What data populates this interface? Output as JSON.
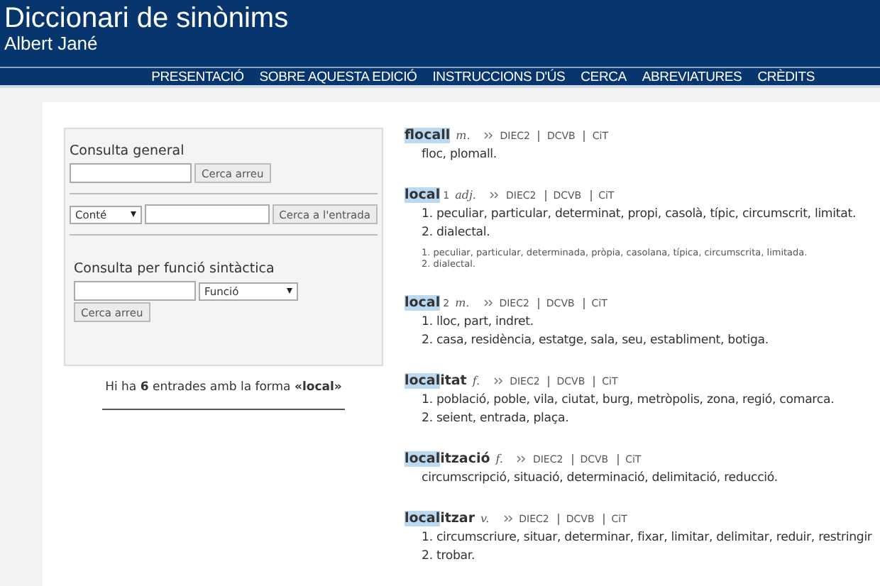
{
  "header": {
    "title": "Diccionari de sinònims",
    "author": "Albert Jané"
  },
  "nav": [
    "PRESENTACIÓ",
    "SOBRE AQUESTA EDICIÓ",
    "INSTRUCCIONS D'ÚS",
    "CERCA",
    "ABREVIATURES",
    "CRÈDITS"
  ],
  "search": {
    "general": {
      "heading": "Consulta general",
      "button": "Cerca arreu"
    },
    "entry": {
      "select": "Conté",
      "button": "Cerca a l'entrada"
    },
    "function": {
      "heading": "Consulta per funció sintàctica",
      "select": "Funció",
      "button": "Cerca arreu"
    },
    "summary": "Hi ha **6** entrades amb la forma **«local»**"
  },
  "entries": [
    {
      "match": "flocall",
      "gram": "m.",
      "links": [
        "DIEC2",
        "DCVB",
        "CiT"
      ],
      "senses": [
        {
          "text": "floc, plomall."
        }
      ]
    },
    {
      "match": "local",
      "sup": "1",
      "gram": "adj.",
      "links": [
        "DIEC2",
        "DCVB",
        "CiT"
      ],
      "senses": [
        {
          "num": "1.",
          "text": "peculiar, particular, determinat, propi, casolà, típic, circumscrit, limitat."
        },
        {
          "num": "2.",
          "text": "dialectal."
        }
      ],
      "notes": [
        {
          "num": "1.",
          "text": "peculiar, particular, determinada, pròpia, casolana, típica, circumscrita, limitada."
        },
        {
          "num": "2.",
          "text": "dialectal."
        }
      ]
    },
    {
      "match": "local",
      "sup": "2",
      "gram": "m.",
      "links": [
        "DIEC2",
        "DCVB",
        "CiT"
      ],
      "senses": [
        {
          "num": "1.",
          "text": "lloc, part, indret."
        },
        {
          "num": "2.",
          "text": "casa, residència, estatge, sala, seu, establiment, botiga."
        }
      ]
    },
    {
      "match": "local",
      "rest": "itat",
      "gram": "f.",
      "links": [
        "DIEC2",
        "DCVB",
        "CiT"
      ],
      "senses": [
        {
          "num": "1.",
          "text": "població, poble, vila, ciutat, burg, metròpolis, zona, regió, comarca."
        },
        {
          "num": "2.",
          "text": "seient, entrada, plaça."
        }
      ]
    },
    {
      "match": "local",
      "rest": "ització",
      "gram": "f.",
      "links": [
        "DIEC2",
        "DCVB",
        "CiT"
      ],
      "senses": [
        {
          "text": "circumscripció, situació, determinació, delimitació, reducció."
        }
      ]
    },
    {
      "match": "local",
      "rest": "itzar",
      "gram": "v.",
      "links": [
        "DIEC2",
        "DCVB",
        "CiT"
      ],
      "senses": [
        {
          "num": "1.",
          "text": "circumscriure, situar, determinar, fixar, limitar, delimitar, reduir, restringir"
        },
        {
          "num": "2.",
          "text": "trobar."
        }
      ]
    }
  ]
}
